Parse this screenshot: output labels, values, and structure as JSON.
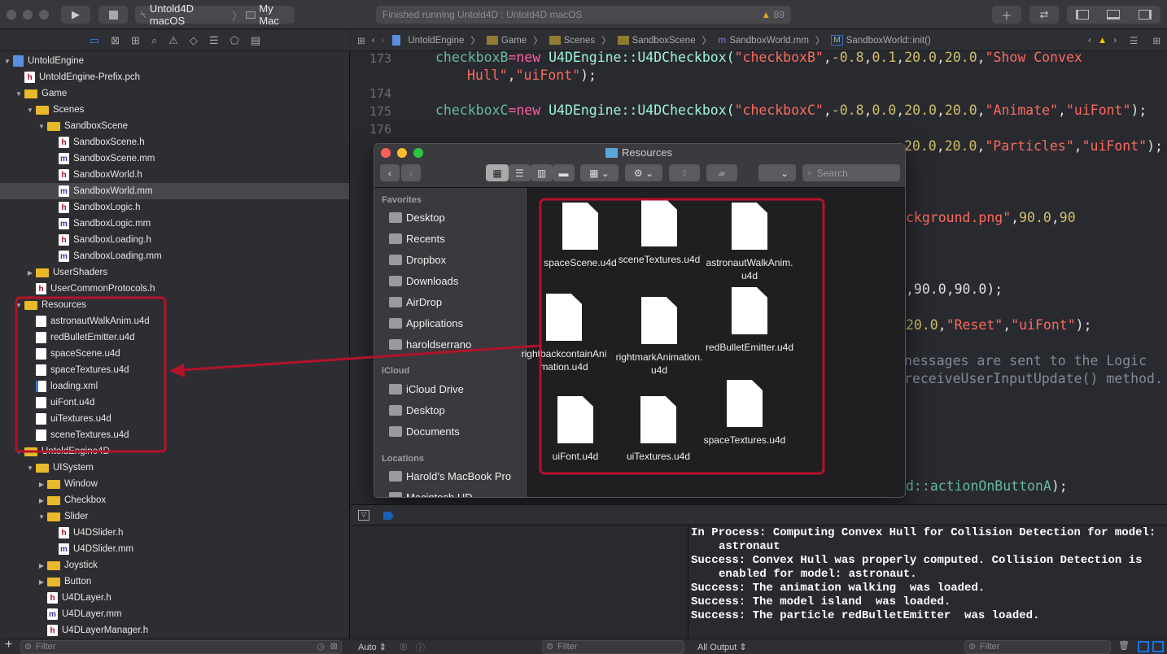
{
  "toolbar": {
    "scheme": "Untold4D macOS",
    "destination": "My Mac",
    "status": "Finished running Untold4D : Untold4D macOS",
    "warning_count": "89"
  },
  "jump_bar": [
    "UntoldEngine",
    "Game",
    "Scenes",
    "SandboxScene",
    "SandboxWorld.mm",
    "SandboxWorld::init()"
  ],
  "navigator": {
    "items": [
      {
        "label": "UntoldEngine",
        "level": 0,
        "icon": "proj",
        "open": true
      },
      {
        "label": "UntoldEngine-Prefix.pch",
        "level": 1,
        "icon": "h"
      },
      {
        "label": "Game",
        "level": 1,
        "icon": "folder",
        "open": true
      },
      {
        "label": "Scenes",
        "level": 2,
        "icon": "folder",
        "open": true
      },
      {
        "label": "SandboxScene",
        "level": 3,
        "icon": "folder",
        "open": true
      },
      {
        "label": "SandboxScene.h",
        "level": 4,
        "icon": "h"
      },
      {
        "label": "SandboxScene.mm",
        "level": 4,
        "icon": "m"
      },
      {
        "label": "SandboxWorld.h",
        "level": 4,
        "icon": "h"
      },
      {
        "label": "SandboxWorld.mm",
        "level": 4,
        "icon": "m",
        "selected": true
      },
      {
        "label": "SandboxLogic.h",
        "level": 4,
        "icon": "h"
      },
      {
        "label": "SandboxLogic.mm",
        "level": 4,
        "icon": "m"
      },
      {
        "label": "SandboxLoading.h",
        "level": 4,
        "icon": "h"
      },
      {
        "label": "SandboxLoading.mm",
        "level": 4,
        "icon": "m"
      },
      {
        "label": "UserShaders",
        "level": 2,
        "icon": "folder",
        "open": false
      },
      {
        "label": "UserCommonProtocols.h",
        "level": 2,
        "icon": "h"
      },
      {
        "label": "Resources",
        "level": 1,
        "icon": "folder",
        "open": true
      },
      {
        "label": "astronautWalkAnim.u4d",
        "level": 2,
        "icon": "doc"
      },
      {
        "label": "redBulletEmitter.u4d",
        "level": 2,
        "icon": "doc"
      },
      {
        "label": "spaceScene.u4d",
        "level": 2,
        "icon": "doc"
      },
      {
        "label": "spaceTextures.u4d",
        "level": 2,
        "icon": "doc"
      },
      {
        "label": "loading.xml",
        "level": 2,
        "icon": "xml"
      },
      {
        "label": "uiFont.u4d",
        "level": 2,
        "icon": "doc"
      },
      {
        "label": "uiTextures.u4d",
        "level": 2,
        "icon": "doc"
      },
      {
        "label": "sceneTextures.u4d",
        "level": 2,
        "icon": "doc"
      },
      {
        "label": "UntoldEngine4D",
        "level": 1,
        "icon": "folder",
        "open": true
      },
      {
        "label": "UISystem",
        "level": 2,
        "icon": "folder",
        "open": true
      },
      {
        "label": "Window",
        "level": 3,
        "icon": "folder",
        "open": false
      },
      {
        "label": "Checkbox",
        "level": 3,
        "icon": "folder",
        "open": false
      },
      {
        "label": "Slider",
        "level": 3,
        "icon": "folder",
        "open": true
      },
      {
        "label": "U4DSlider.h",
        "level": 4,
        "icon": "h"
      },
      {
        "label": "U4DSlider.mm",
        "level": 4,
        "icon": "m"
      },
      {
        "label": "Joystick",
        "level": 3,
        "icon": "folder",
        "open": false
      },
      {
        "label": "Button",
        "level": 3,
        "icon": "folder",
        "open": false
      },
      {
        "label": "U4DLayer.h",
        "level": 3,
        "icon": "h"
      },
      {
        "label": "U4DLayer.mm",
        "level": 3,
        "icon": "m"
      },
      {
        "label": "U4DLayerManager.h",
        "level": 3,
        "icon": "h"
      }
    ],
    "filter_placeholder": "Filter"
  },
  "editor": {
    "line_numbers": [
      "173",
      "174",
      "175",
      "176"
    ],
    "line173a": [
      "checkboxB",
      "=",
      "new",
      " U4DEngine::U4DCheckbox(",
      "\"checkboxB\"",
      ",",
      "-0.8",
      ",",
      "0.1",
      ",",
      "20.0",
      ",",
      "20.0",
      ",",
      "\"Show Convex"
    ],
    "line173b": [
      "Hull\"",
      ",",
      "\"uiFont\"",
      ");"
    ],
    "line175": [
      "checkboxC",
      "=",
      "new",
      " U4DEngine::U4DCheckbox(",
      "\"checkboxC\"",
      ",",
      "-0.8",
      ",",
      "0.0",
      ",",
      "20.0",
      ",",
      "20.0",
      ",",
      "\"Animate\"",
      ",",
      "\"uiFont\"",
      ");"
    ],
    "frag177": [
      "20.0",
      ",",
      "20.0",
      ",",
      "\"Particles\"",
      ",",
      "\"uiFont\"",
      ");"
    ],
    "frag_bg": [
      "ckground.png\"",
      ",",
      "90.0",
      ",",
      "90"
    ],
    "frag_90": [
      ",90.0,90.0);"
    ],
    "frag_reset": [
      "20.0",
      ",",
      "\"Reset\"",
      ",",
      "\"uiFont\"",
      ");"
    ],
    "frag_cm1": "nessages are sent to the Logic",
    "frag_cm2": "receiveUserInputUpdate() method.",
    "frag_action": [
      "d::",
      "actionOnButtonA",
      ");"
    ]
  },
  "finder": {
    "title": "Resources",
    "search_placeholder": "Search",
    "sidebar": {
      "favorites_header": "Favorites",
      "favorites": [
        "Desktop",
        "Recents",
        "Dropbox",
        "Downloads",
        "AirDrop",
        "Applications",
        "haroldserrano"
      ],
      "icloud_header": "iCloud",
      "icloud": [
        "iCloud Drive",
        "Desktop",
        "Documents"
      ],
      "locations_header": "Locations",
      "locations": [
        "Harold’s MacBook Pro",
        "Macintosh HD"
      ]
    },
    "files": [
      "spaceScene.u4d",
      "sceneTextures.u4d",
      "astronautWalkAnim.u4d",
      "rightbackcontainAnimation.u4d",
      "rightmarkAnimation.u4d",
      "redBulletEmitter.u4d",
      "uiFont.u4d",
      "uiTextures.u4d",
      "spaceTextures.u4d"
    ]
  },
  "console": {
    "lines": [
      "In Process: Computing Convex Hull for Collision Detection for model: astronaut",
      "Success: Convex Hull was properly computed. Collision Detection is enabled for model: astronaut.",
      "Success: The animation walking  was loaded.",
      "Success: The model island  was loaded.",
      "Success: The particle redBulletEmitter  was loaded."
    ],
    "auto_label": "Auto",
    "output_label": "All Output",
    "filter_placeholder": "Filter"
  },
  "colors": {
    "annotation": "#b3122a",
    "accent": "#1a73e8",
    "warning": "#f5c400"
  }
}
